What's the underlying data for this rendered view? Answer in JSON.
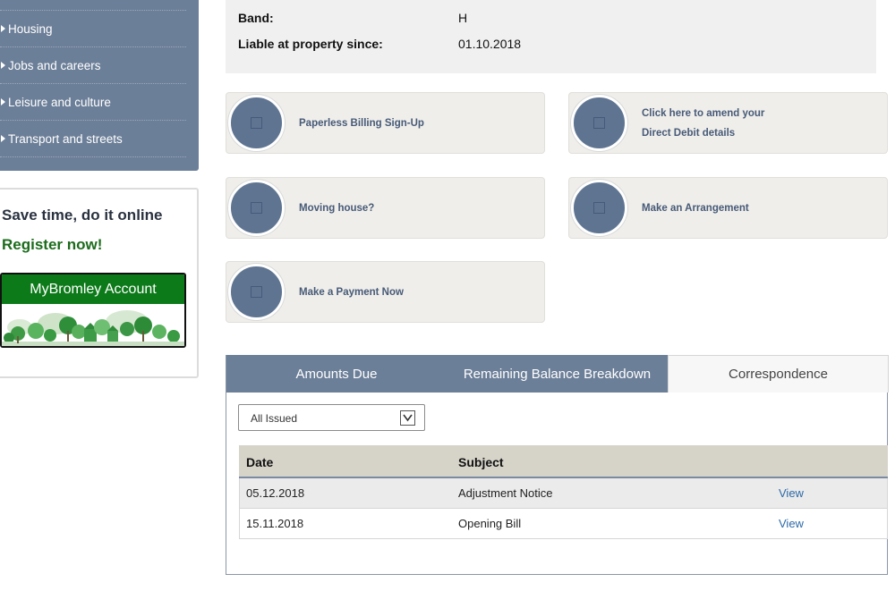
{
  "sidebar": {
    "items": [
      {
        "label": "Housing"
      },
      {
        "label": "Jobs and careers"
      },
      {
        "label": "Leisure and culture"
      },
      {
        "label": "Transport and streets"
      }
    ]
  },
  "promo": {
    "title": "Save time, do it online",
    "register": "Register now!",
    "account_label": "MyBromley Account"
  },
  "property": {
    "band_label": "Band:",
    "band_value": "H",
    "liable_label": "Liable at property since:",
    "liable_value": "01.10.2018"
  },
  "actions": [
    {
      "label": "Paperless Billing Sign-Up"
    },
    {
      "label_line1": "Click here to amend your",
      "label_line2": "Direct Debit details"
    },
    {
      "label": "Moving house?"
    },
    {
      "label": "Make an Arrangement"
    },
    {
      "label": "Make a Payment Now"
    }
  ],
  "tabs": [
    {
      "label": "Amounts Due"
    },
    {
      "label": "Remaining Balance Breakdown"
    },
    {
      "label": "Correspondence"
    }
  ],
  "filter": {
    "selected": "All Issued"
  },
  "table": {
    "headers": {
      "date": "Date",
      "subject": "Subject"
    },
    "rows": [
      {
        "date": "05.12.2018",
        "subject": "Adjustment Notice",
        "action": "View"
      },
      {
        "date": "15.11.2018",
        "subject": "Opening Bill",
        "action": "View"
      }
    ]
  },
  "colors": {
    "nav_bg": "#6c7f98",
    "accent_green": "#1c6b1c",
    "link_blue": "#2d6aa8",
    "action_circle": "#5e7491"
  }
}
